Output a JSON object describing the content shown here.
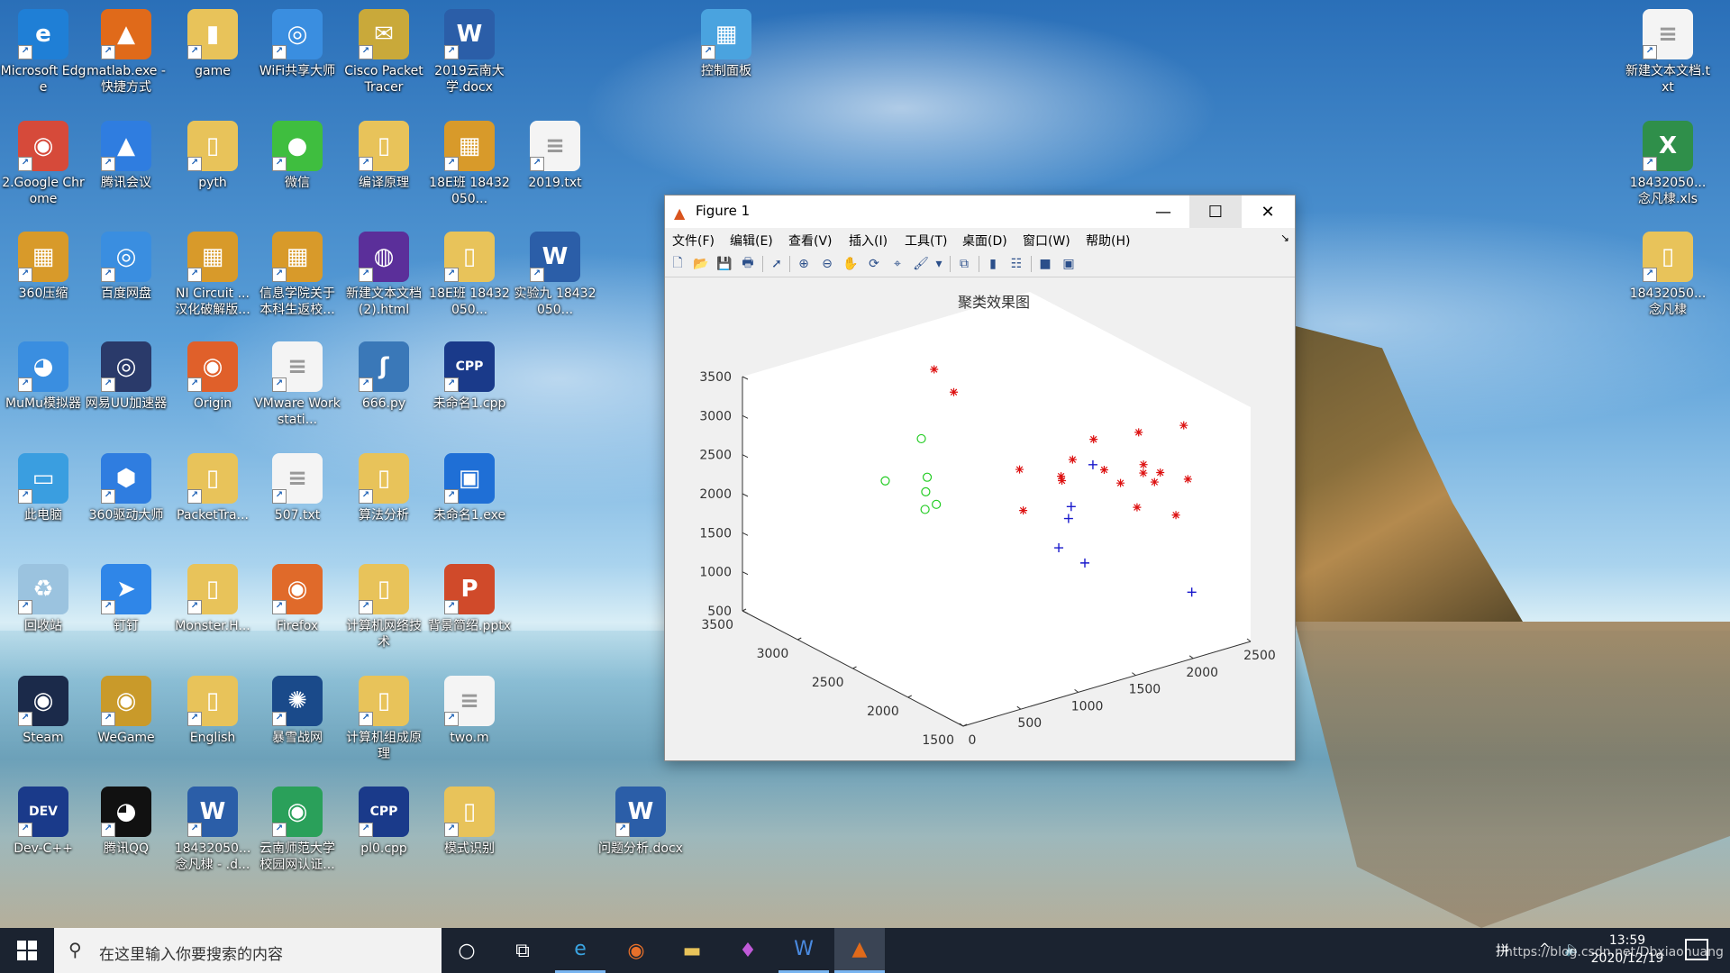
{
  "desktop": {
    "icons": [
      {
        "label": "Microsoft Edge",
        "glyph": "e",
        "color": "#1f7fd6"
      },
      {
        "label": "matlab.exe - 快捷方式",
        "glyph": "▲",
        "color": "#e06a1a"
      },
      {
        "label": "game",
        "glyph": "▮",
        "color": "#e8c35a"
      },
      {
        "label": "WiFi共享大师",
        "glyph": "◎",
        "color": "#3a8ee0"
      },
      {
        "label": "Cisco Packet Tracer",
        "glyph": "✉",
        "color": "#c9a93a"
      },
      {
        "label": "2019云南大学.docx",
        "glyph": "W",
        "color": "#2b5ea8"
      },
      {
        "label": "控制面板",
        "glyph": "▦",
        "color": "#4aa3df"
      },
      {
        "label": "新建文本文档.txt",
        "glyph": "≡",
        "color": "#f4f4f4"
      },
      {
        "label": "2.Google Chrome",
        "glyph": "◉",
        "color": "#d64a3a"
      },
      {
        "label": "腾讯会议",
        "glyph": "▲",
        "color": "#2f7de0"
      },
      {
        "label": "pyth",
        "glyph": "▯",
        "color": "#e8c35a"
      },
      {
        "label": "微信",
        "glyph": "●",
        "color": "#3fbe3f"
      },
      {
        "label": "编译原理",
        "glyph": "▯",
        "color": "#e8c35a"
      },
      {
        "label": "18E班 18432050...",
        "glyph": "▦",
        "color": "#d89a2a"
      },
      {
        "label": "2019.txt",
        "glyph": "≡",
        "color": "#f4f4f4"
      },
      {
        "label": "18432050... 念凡棣.xls",
        "glyph": "X",
        "color": "#2f8f4a"
      },
      {
        "label": "360压缩",
        "glyph": "▦",
        "color": "#d89a2a"
      },
      {
        "label": "百度网盘",
        "glyph": "◎",
        "color": "#3a8ee0"
      },
      {
        "label": "NI Circuit ... 汉化破解版...",
        "glyph": "▦",
        "color": "#d89a2a"
      },
      {
        "label": "信息学院关于本科生返校...",
        "glyph": "▦",
        "color": "#d89a2a"
      },
      {
        "label": "新建文本文档(2).html",
        "glyph": "◍",
        "color": "#5b2f9a"
      },
      {
        "label": "18E班 18432050...",
        "glyph": "▯",
        "color": "#e8c35a"
      },
      {
        "label": "实验九 18432050...",
        "glyph": "W",
        "color": "#2b5ea8"
      },
      {
        "label": "18432050... 念凡棣",
        "glyph": "▯",
        "color": "#e8c35a"
      },
      {
        "label": "MuMu模拟器",
        "glyph": "◕",
        "color": "#3a8ee0"
      },
      {
        "label": "网易UU加速器",
        "glyph": "◎",
        "color": "#2a3a6a"
      },
      {
        "label": "Origin",
        "glyph": "◉",
        "color": "#e0602a"
      },
      {
        "label": "VMware Workstati...",
        "glyph": "≡",
        "color": "#f4f4f4"
      },
      {
        "label": "666.py",
        "glyph": "ʃ",
        "color": "#3a78b8"
      },
      {
        "label": "未命名1.cpp",
        "glyph": "CPP",
        "color": "#1a3a8a"
      },
      {
        "label": "此电脑",
        "glyph": "▭",
        "color": "#3a9ee0"
      },
      {
        "label": "360驱动大师",
        "glyph": "⬢",
        "color": "#2f7de0"
      },
      {
        "label": "PacketTra...",
        "glyph": "▯",
        "color": "#e8c35a"
      },
      {
        "label": "507.txt",
        "glyph": "≡",
        "color": "#f4f4f4"
      },
      {
        "label": "算法分析",
        "glyph": "▯",
        "color": "#e8c35a"
      },
      {
        "label": "未命名1.exe",
        "glyph": "▣",
        "color": "#1f6fd6"
      },
      {
        "label": "回收站",
        "glyph": "♻",
        "color": "#9bc3df"
      },
      {
        "label": "钉钉",
        "glyph": "➤",
        "color": "#2f86e8"
      },
      {
        "label": "Monster.H...",
        "glyph": "▯",
        "color": "#e8c35a"
      },
      {
        "label": "Firefox",
        "glyph": "◉",
        "color": "#e06a2a"
      },
      {
        "label": "计算机网络技术",
        "glyph": "▯",
        "color": "#e8c35a"
      },
      {
        "label": "背景简绍.pptx",
        "glyph": "P",
        "color": "#d04a2a"
      },
      {
        "label": "Steam",
        "glyph": "◉",
        "color": "#1b2a4a"
      },
      {
        "label": "WeGame",
        "glyph": "◉",
        "color": "#c99a2a"
      },
      {
        "label": "English",
        "glyph": "▯",
        "color": "#e8c35a"
      },
      {
        "label": "暴雪战网",
        "glyph": "✺",
        "color": "#1a4a8a"
      },
      {
        "label": "计算机组成原理",
        "glyph": "▯",
        "color": "#e8c35a"
      },
      {
        "label": "two.m",
        "glyph": "≡",
        "color": "#f4f4f4"
      },
      {
        "label": "Dev-C++",
        "glyph": "DEV",
        "color": "#1a3a8a"
      },
      {
        "label": "腾讯QQ",
        "glyph": "◕",
        "color": "#111111"
      },
      {
        "label": "18432050... 念凡棣 - .d...",
        "glyph": "W",
        "color": "#2b5ea8"
      },
      {
        "label": "云南师范大学校园网认证...",
        "glyph": "◉",
        "color": "#2aa05a"
      },
      {
        "label": "pl0.cpp",
        "glyph": "CPP",
        "color": "#1a3a8a"
      },
      {
        "label": "模式识别",
        "glyph": "▯",
        "color": "#e8c35a"
      },
      {
        "label": "问题分析.docx",
        "glyph": "W",
        "color": "#2b5ea8"
      }
    ]
  },
  "window": {
    "title": "Figure 1",
    "menu": [
      "文件(F)",
      "编辑(E)",
      "查看(V)",
      "插入(I)",
      "工具(T)",
      "桌面(D)",
      "窗口(W)",
      "帮助(H)"
    ]
  },
  "chart_data": {
    "type": "scatter",
    "title": "聚类效果图",
    "zlim": [
      500,
      3500
    ],
    "z_ticks": [
      500,
      1000,
      1500,
      2000,
      2500,
      3000,
      3500
    ],
    "y_ticks": [
      1500,
      2000,
      2500,
      3000,
      3500
    ],
    "x_ticks": [
      0,
      500,
      1000,
      1500,
      2000,
      2500
    ],
    "grid": false,
    "series": [
      {
        "marker": "o",
        "color": "#22cc22",
        "points": [
          [
            -150,
            2050,
            3300
          ],
          [
            100,
            1950,
            2900
          ],
          [
            150,
            1900,
            2980
          ],
          [
            250,
            2100,
            2950
          ],
          [
            330,
            2170,
            3050
          ],
          [
            500,
            2400,
            3300
          ]
        ]
      },
      {
        "marker": "+",
        "color": "#1a1acc",
        "points": [
          [
            1100,
            1780,
            2100
          ],
          [
            1300,
            1900,
            2300
          ],
          [
            1250,
            1700,
            1900
          ],
          [
            1400,
            1980,
            2350
          ],
          [
            1800,
            2200,
            2550
          ],
          [
            1700,
            1200,
            1700
          ]
        ]
      },
      {
        "marker": "*",
        "color": "#dd1111",
        "points": [
          [
            1050,
            2050,
            2400
          ],
          [
            1450,
            2500,
            2420
          ],
          [
            1550,
            3200,
            2850
          ],
          [
            1600,
            3430,
            2950
          ],
          [
            1550,
            2220,
            2440
          ],
          [
            1600,
            2280,
            2430
          ],
          [
            1700,
            2280,
            2600
          ],
          [
            1800,
            1950,
            2500
          ],
          [
            1850,
            2150,
            2500
          ],
          [
            1950,
            2350,
            2700
          ],
          [
            1950,
            1900,
            2600
          ],
          [
            2000,
            1850,
            2500
          ],
          [
            2050,
            1850,
            2600
          ],
          [
            2150,
            2150,
            2850
          ],
          [
            1850,
            1500,
            2400
          ],
          [
            2050,
            1600,
            2700
          ],
          [
            2350,
            1950,
            3000
          ],
          [
            1800,
            1800,
            2300
          ],
          [
            2000,
            1950,
            2650
          ]
        ]
      }
    ]
  },
  "taskbar": {
    "search_placeholder": "在这里输入你要搜索的内容",
    "time": "13:59",
    "date": "2020/12/19",
    "ime": "拼",
    "watermark": "https://blog.csdn.net/Dbxiaohuang"
  }
}
